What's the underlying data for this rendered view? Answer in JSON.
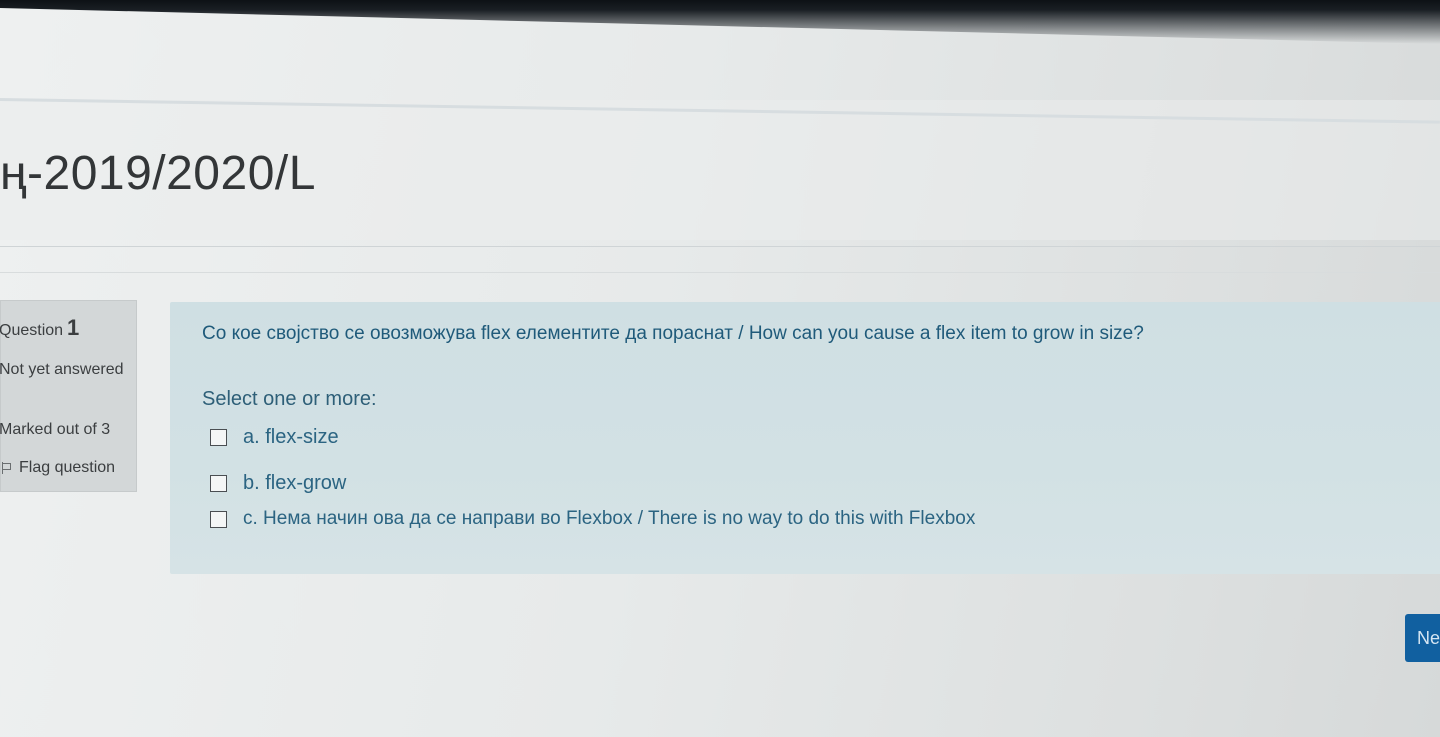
{
  "page": {
    "course_title": "ң-2019/2020/L"
  },
  "question_info": {
    "label": "Question",
    "number": "1",
    "state": "Not yet answered",
    "grade": "Marked out of 3",
    "flag_label": "Flag question"
  },
  "question": {
    "text": "Со кое својство се овозможува flex елементите да пораснат / How can you cause a flex item to grow in size?",
    "prompt": "Select one or more:",
    "answers": [
      {
        "label": "a. flex-size",
        "checked": false
      },
      {
        "label": "b. flex-grow",
        "checked": false
      },
      {
        "label": "c. Нема начин ова да се направи во Flexbox / There is no way to do this with Flexbox",
        "checked": false
      }
    ]
  },
  "navigation": {
    "next_label": "Ne"
  },
  "icons": {
    "flag": "flag-icon",
    "checkbox": "checkbox-icon"
  }
}
